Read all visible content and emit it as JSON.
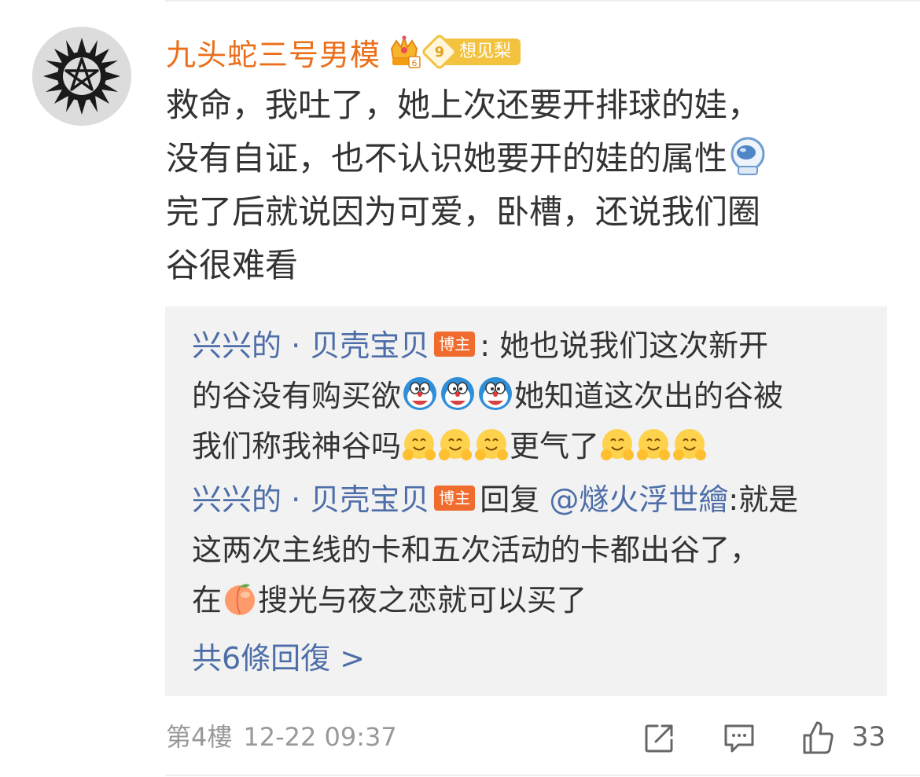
{
  "comment": {
    "author": "九头蛇三号男模",
    "fan_badge": {
      "level": "9",
      "name": "想见梨"
    },
    "crown_badge_icon": "vip-crown-icon",
    "lines": [
      "救命，我吐了，她上次还要开排球的娃，",
      "没有自证，也不认识她要开的娃的属性",
      "完了后就说因为可爱，卧槽，还说我们圈",
      "谷很难看"
    ],
    "inline_emoji": "astronaut-emoji"
  },
  "replies": [
    {
      "author": "兴兴的 · 贝壳宝贝",
      "badge": "博主",
      "separator": ":",
      "parts": [
        "她也说我们这次新开",
        "的谷没有购买欲",
        "她知道这次出的谷被",
        "我们称我神谷吗",
        "更气了"
      ],
      "emojis": [
        "doraemon-emoji",
        "hug-emoji"
      ]
    },
    {
      "author": "兴兴的 · 贝壳宝贝",
      "badge": "博主",
      "reply_word": "回复",
      "mention": "@燧火浮世繪",
      "parts": [
        ":就是",
        "这两次主线的卡和五次活动的卡都出谷了，",
        "在",
        "搜光与夜之恋就可以买了"
      ],
      "emojis": [
        "peach-emoji"
      ]
    }
  ],
  "more_replies": "共6條回復 >",
  "footer": {
    "floor": "第4樓",
    "time": "12-22 09:37",
    "like_count": "33",
    "icons": [
      "repost-icon",
      "comment-icon",
      "like-icon"
    ]
  },
  "colors": {
    "username": "#eb6f1a",
    "link": "#4d6ea8",
    "badge": "#f06c2e",
    "fan_badge": "#f3c23e",
    "reply_bg": "#f2f2f2"
  }
}
